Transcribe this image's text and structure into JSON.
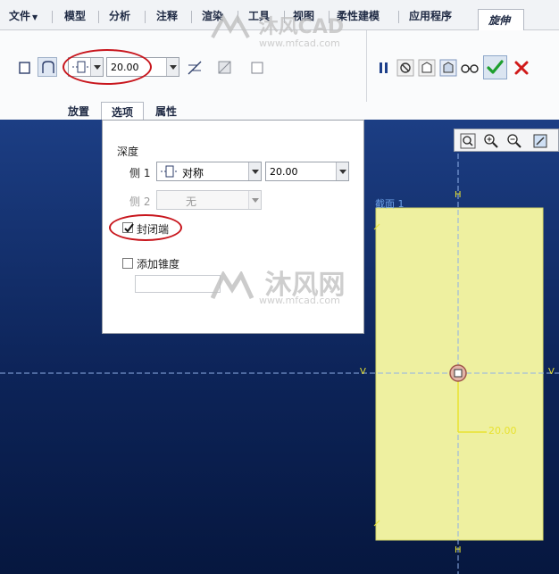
{
  "menubar": {
    "items": [
      "文件",
      "模型",
      "分析",
      "注释",
      "渲染",
      "工具",
      "视图",
      "柔性建模",
      "应用程序"
    ],
    "active_tab": "旋伸"
  },
  "toolbar": {
    "depth_value": "20.00",
    "accent_green": "#1e9f2e",
    "accent_red": "#d01a1a"
  },
  "subtabs": [
    "放置",
    "选项",
    "属性"
  ],
  "options_panel": {
    "depth_label": "深度",
    "side1_label": "侧 1",
    "side1_mode": "对称",
    "side1_value": "20.00",
    "side2_label": "侧 2",
    "side2_mode": "无",
    "capped_ends_label": "封闭端",
    "add_taper_label": "添加锥度"
  },
  "canvas": {
    "section_label": "截面 1",
    "h_marker": "H",
    "v_marker": "V",
    "dimension_value": "20.00"
  },
  "watermark": {
    "brand": "沐风CAD",
    "brand_cn": "沐风网",
    "url": "www.mfcad.com"
  }
}
